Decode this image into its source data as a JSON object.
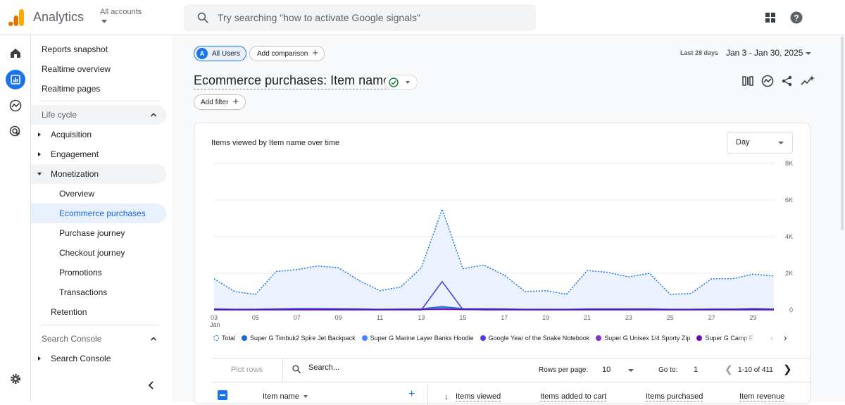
{
  "header": {
    "brand": "Analytics",
    "account_label": "All accounts",
    "search_placeholder": "Try searching \"how to activate Google signals\""
  },
  "nav": {
    "reports_snapshot": "Reports snapshot",
    "realtime_overview": "Realtime overview",
    "realtime_pages": "Realtime pages",
    "life_cycle": "Life cycle",
    "acquisition": "Acquisition",
    "engagement": "Engagement",
    "monetization": "Monetization",
    "overview": "Overview",
    "ecommerce_purchases": "Ecommerce purchases",
    "purchase_journey": "Purchase journey",
    "checkout_journey": "Checkout journey",
    "promotions": "Promotions",
    "transactions": "Transactions",
    "retention": "Retention",
    "search_console_section": "Search Console",
    "search_console": "Search Console"
  },
  "toolbar": {
    "segment_badge": "A",
    "segment": "All Users",
    "add_comparison": "Add comparison",
    "range_label": "Last 28 days",
    "range_value": "Jan 3 - Jan 30, 2025"
  },
  "report": {
    "title": "Ecommerce purchases: Item name",
    "add_filter": "Add filter"
  },
  "card": {
    "chart_title": "Items viewed by Item name over time",
    "granularity": "Day"
  },
  "chart_data": {
    "type": "line",
    "title": "Items viewed by Item name over time",
    "x_tick_labels": [
      "03",
      "05",
      "07",
      "09",
      "11",
      "13",
      "15",
      "17",
      "19",
      "21",
      "23",
      "25",
      "27",
      "29"
    ],
    "x_first_month": "Jan",
    "y_tick_labels": [
      "8K",
      "6K",
      "4K",
      "2K",
      "0"
    ],
    "ylim": [
      0,
      8000
    ],
    "x": [
      3,
      4,
      5,
      6,
      7,
      8,
      9,
      10,
      11,
      12,
      13,
      14,
      15,
      16,
      17,
      18,
      19,
      20,
      21,
      22,
      23,
      24,
      25,
      26,
      27,
      28,
      29,
      30
    ],
    "series": [
      {
        "name": "Total",
        "color": "#1a73e8",
        "values": [
          1700,
          1000,
          850,
          2100,
          2200,
          2400,
          2300,
          1600,
          1050,
          1250,
          2300,
          5500,
          2250,
          2450,
          1900,
          1000,
          1050,
          850,
          2150,
          2050,
          1800,
          2000,
          850,
          900,
          1700,
          1700,
          1950,
          1850
        ]
      },
      {
        "name": "Super G Timbuk2 Spire Jet Backpack",
        "color": "#1967d2",
        "values": [
          60,
          40,
          40,
          60,
          80,
          80,
          70,
          60,
          40,
          50,
          60,
          180,
          70,
          70,
          60,
          40,
          40,
          40,
          60,
          60,
          60,
          60,
          40,
          40,
          50,
          50,
          80,
          50
        ]
      },
      {
        "name": "Super G Marine Layer Banks Hoodie",
        "color": "#4285f4",
        "values": [
          40,
          30,
          30,
          50,
          60,
          60,
          50,
          40,
          30,
          40,
          50,
          120,
          50,
          50,
          40,
          30,
          30,
          30,
          50,
          50,
          40,
          40,
          30,
          30,
          40,
          40,
          60,
          40
        ]
      },
      {
        "name": "Google Year of the Snake Notebook",
        "color": "#4a3fd8",
        "values": [
          0,
          0,
          0,
          0,
          0,
          0,
          0,
          0,
          0,
          0,
          0,
          1550,
          20,
          0,
          0,
          0,
          0,
          0,
          0,
          0,
          0,
          0,
          0,
          0,
          0,
          0,
          0,
          0
        ]
      },
      {
        "name": "Super G Unisex 1/4 Sporty Zip",
        "color": "#8430ce",
        "values": [
          30,
          20,
          20,
          30,
          40,
          40,
          30,
          30,
          20,
          30,
          30,
          60,
          30,
          30,
          30,
          20,
          20,
          20,
          30,
          30,
          30,
          30,
          20,
          20,
          30,
          30,
          30,
          30
        ]
      },
      {
        "name": "Super G Camp F",
        "color": "#6a0dad",
        "values": [
          20,
          10,
          10,
          20,
          20,
          20,
          20,
          20,
          10,
          20,
          20,
          40,
          20,
          20,
          20,
          10,
          10,
          10,
          20,
          20,
          20,
          20,
          10,
          10,
          20,
          20,
          20,
          20
        ]
      }
    ],
    "legend_placement": "bottom",
    "grid": true
  },
  "table": {
    "plot_rows": "Plot rows",
    "search_placeholder": "Search...",
    "rows_per_page_label": "Rows per page:",
    "rows_per_page": "10",
    "goto_label": "Go to:",
    "goto_value": "1",
    "page_range": "1-10 of 411",
    "col_item_name": "Item name",
    "col_items_viewed": "Items viewed",
    "col_added_to_cart": "Items added to cart",
    "col_purchased": "Items purchased",
    "col_revenue": "Item revenue"
  },
  "colors": {
    "accent": "#1a73e8",
    "logo_orange": "#f9ab00",
    "logo_dark": "#e37400"
  }
}
